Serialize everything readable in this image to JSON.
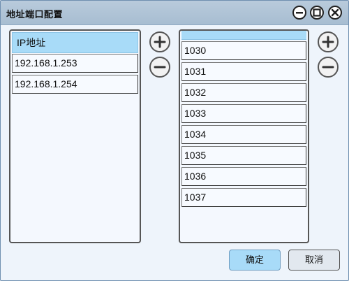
{
  "window": {
    "title": "地址端口配置"
  },
  "controls": {
    "minimize": "minimize-icon",
    "maximize": "maximize-icon",
    "close": "close-icon"
  },
  "ip_list": {
    "header": "IP地址",
    "items": [
      "192.168.1.253",
      "192.168.1.254"
    ]
  },
  "port_list": {
    "header": "",
    "items": [
      "1030",
      "1031",
      "1032",
      "1033",
      "1034",
      "1035",
      "1036",
      "1037"
    ]
  },
  "buttons": {
    "ok": "确定",
    "cancel": "取消"
  },
  "colors": {
    "accent": "#a8dbf8",
    "titlebar": "#aec2d6",
    "background": "#eef4fb"
  }
}
